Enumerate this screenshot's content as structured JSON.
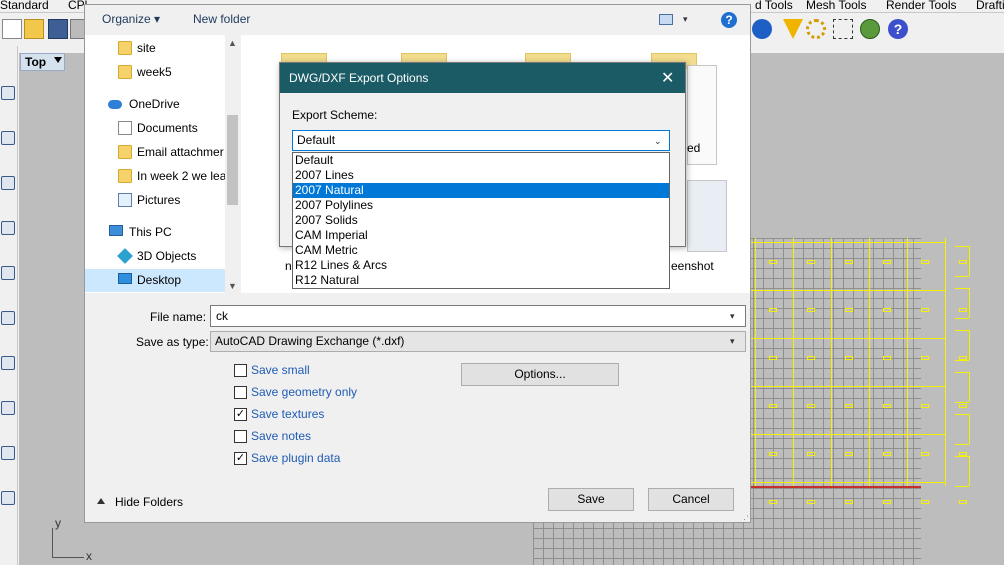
{
  "rhino": {
    "tabs": [
      "Standard",
      "CPl",
      "d Tools",
      "Mesh Tools",
      "Render Tools",
      "Draftin"
    ],
    "viewport": {
      "label": "Top",
      "axis_x": "x",
      "axis_y": "y"
    }
  },
  "save_dialog": {
    "toolbar": {
      "organize": "Organize",
      "organize_arrow": "▾",
      "new_folder": "New folder",
      "help": "?",
      "view_arrow": "▾"
    },
    "nav": {
      "items": [
        {
          "label": "site",
          "icon": "folder-icon"
        },
        {
          "label": "week5",
          "icon": "folder-icon"
        },
        {
          "label": "OneDrive",
          "icon": "cloud-icon"
        },
        {
          "label": "Documents",
          "icon": "documents-icon"
        },
        {
          "label": "Email attachmer",
          "icon": "folder-icon"
        },
        {
          "label": "In week 2 we lea",
          "icon": "folder-icon"
        },
        {
          "label": "Pictures",
          "icon": "pictures-icon"
        },
        {
          "label": "This PC",
          "icon": "pc-icon"
        },
        {
          "label": "3D Objects",
          "icon": "cube-icon"
        },
        {
          "label": "Desktop",
          "icon": "desktop-icon"
        }
      ],
      "scroll_up": "▲",
      "scroll_down": "▼"
    },
    "files": [
      {
        "label": "ed"
      },
      {
        "label": "n"
      },
      {
        "label": "eenshot"
      }
    ],
    "file_name": {
      "label": "File name:",
      "value": "ck",
      "arrow": "▾"
    },
    "save_as_type": {
      "label": "Save as type:",
      "value": "AutoCAD Drawing Exchange (*.dxf)",
      "arrow": "▾"
    },
    "checkboxes": [
      {
        "label": "Save small",
        "checked": false,
        "mark": ""
      },
      {
        "label": "Save geometry only",
        "checked": false,
        "mark": ""
      },
      {
        "label": "Save textures",
        "checked": true,
        "mark": "✓"
      },
      {
        "label": "Save notes",
        "checked": false,
        "mark": ""
      },
      {
        "label": "Save plugin data",
        "checked": true,
        "mark": "✓"
      }
    ],
    "options_button": "Options...",
    "hide_folders": "Hide Folders",
    "save_button": "Save",
    "cancel_button": "Cancel"
  },
  "dxf_dialog": {
    "title": "DWG/DXF Export Options",
    "close": "✕",
    "scheme_label": "Export Scheme:",
    "scheme_selected": "Default",
    "scheme_arrow": "⌄",
    "options": [
      "Default",
      "2007 Lines",
      "2007 Natural",
      "2007 Polylines",
      "2007 Solids",
      "CAM Imperial",
      "CAM Metric",
      "R12 Lines & Arcs",
      "R12 Natural"
    ],
    "highlighted": "2007 Natural"
  },
  "colors": {
    "accent": "#0078d7",
    "dialog_title": "#1b5b66",
    "link": "#1f5cb5",
    "pattern": "#f5f000"
  }
}
